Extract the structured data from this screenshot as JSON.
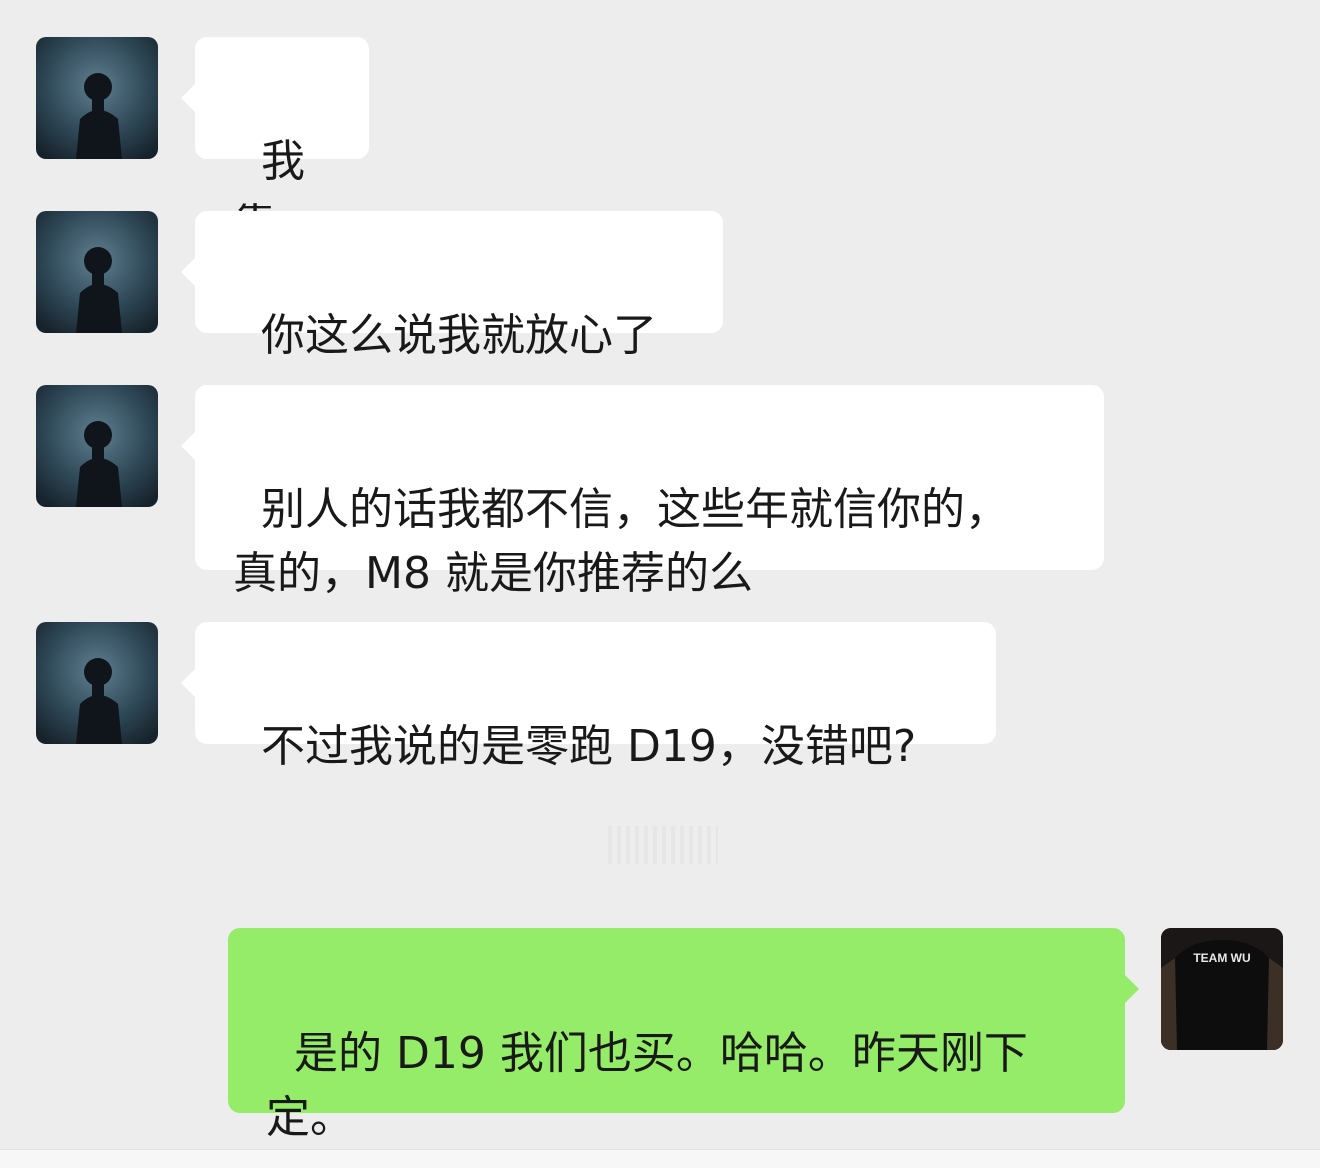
{
  "chat": {
    "messages": [
      {
        "sender": "contact",
        "text": "我靠"
      },
      {
        "sender": "contact",
        "text": "你这么说我就放心了"
      },
      {
        "sender": "contact",
        "text": "别人的话我都不信，这些年就信你的，\n真的，M8 就是你推荐的么"
      },
      {
        "sender": "contact",
        "text": "不过我说的是零跑 D19，没错吧?"
      },
      {
        "sender": "me",
        "text": "是的 D19 我们也买。哈哈。昨天刚下\n定。"
      }
    ],
    "self_avatar_text": "TEAM WU"
  },
  "colors": {
    "background": "#ededed",
    "incoming_bubble": "#ffffff",
    "outgoing_bubble": "#95ec69",
    "text": "#191919"
  },
  "icons": {
    "contact_avatar": "silhouette-avatar-icon",
    "self_avatar": "black-tshirt-avatar-icon"
  }
}
